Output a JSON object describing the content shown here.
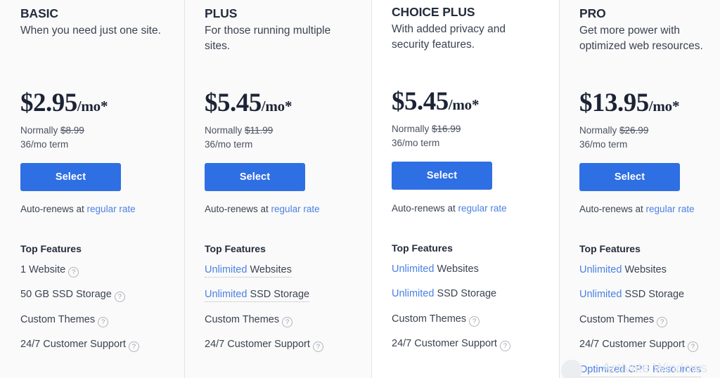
{
  "plans": [
    {
      "name": "BASIC",
      "description": "When you need just one site.",
      "price": "$2.95",
      "period": "/mo*",
      "normally_label": "Normally",
      "normally_price": "$8.99",
      "term": "36/mo term",
      "select_label": "Select",
      "autorenew_prefix": "Auto-renews at ",
      "autorenew_link": "regular rate",
      "features_title": "Top Features",
      "features": [
        {
          "highlight": "",
          "text": "1 Website",
          "help": true,
          "dotted": false
        },
        {
          "highlight": "",
          "text": "50 GB SSD Storage",
          "help": true,
          "dotted": false
        },
        {
          "highlight": "",
          "text": "Custom Themes",
          "help": true,
          "dotted": false
        },
        {
          "highlight": "",
          "text": "24/7 Customer Support",
          "help": true,
          "dotted": false
        }
      ]
    },
    {
      "name": "PLUS",
      "description": "For those running multiple sites.",
      "price": "$5.45",
      "period": "/mo*",
      "normally_label": "Normally",
      "normally_price": "$11.99",
      "term": "36/mo term",
      "select_label": "Select",
      "autorenew_prefix": "Auto-renews at ",
      "autorenew_link": "regular rate",
      "features_title": "Top Features",
      "features": [
        {
          "highlight": "Unlimited",
          "text": " Websites",
          "help": false,
          "dotted": true
        },
        {
          "highlight": "Unlimited",
          "text": " SSD Storage",
          "help": false,
          "dotted": true
        },
        {
          "highlight": "",
          "text": "Custom Themes",
          "help": true,
          "dotted": false
        },
        {
          "highlight": "",
          "text": "24/7 Customer Support",
          "help": true,
          "dotted": false
        }
      ]
    },
    {
      "name": "CHOICE PLUS",
      "description": "With added privacy and security features.",
      "price": "$5.45",
      "period": "/mo*",
      "normally_label": "Normally",
      "normally_price": "$16.99",
      "term": "36/mo term",
      "select_label": "Select",
      "autorenew_prefix": "Auto-renews at ",
      "autorenew_link": "regular rate",
      "features_title": "Top Features",
      "features": [
        {
          "highlight": "Unlimited",
          "text": " Websites",
          "help": false,
          "dotted": false
        },
        {
          "highlight": "Unlimited",
          "text": " SSD Storage",
          "help": false,
          "dotted": false
        },
        {
          "highlight": "",
          "text": "Custom Themes",
          "help": true,
          "dotted": false
        },
        {
          "highlight": "",
          "text": "24/7 Customer Support",
          "help": true,
          "dotted": false
        }
      ]
    },
    {
      "name": "PRO",
      "description": "Get more power with optimized web resources.",
      "price": "$13.95",
      "period": "/mo*",
      "normally_label": "Normally",
      "normally_price": "$26.99",
      "term": "36/mo term",
      "select_label": "Select",
      "autorenew_prefix": "Auto-renews at ",
      "autorenew_link": "regular rate",
      "features_title": "Top Features",
      "features": [
        {
          "highlight": "Unlimited",
          "text": " Websites",
          "help": false,
          "dotted": false
        },
        {
          "highlight": "Unlimited",
          "text": " SSD Storage",
          "help": false,
          "dotted": false
        },
        {
          "highlight": "",
          "text": "Custom Themes",
          "help": true,
          "dotted": false
        },
        {
          "highlight": "",
          "text": "24/7 Customer Support",
          "help": true,
          "dotted": false
        },
        {
          "highlight": "Optimized CPU Resources",
          "text": "",
          "help": false,
          "dotted": true
        }
      ]
    }
  ],
  "help_icon_glyph": "?",
  "watermark": "Activate Windows",
  "colors": {
    "accent": "#2f6fe4",
    "link": "#4a80e4",
    "heading": "#242c3d",
    "body": "#3b4351",
    "panel": "#fafafa",
    "panel_featured": "#ffffff",
    "divider": "#e3e3e3"
  }
}
